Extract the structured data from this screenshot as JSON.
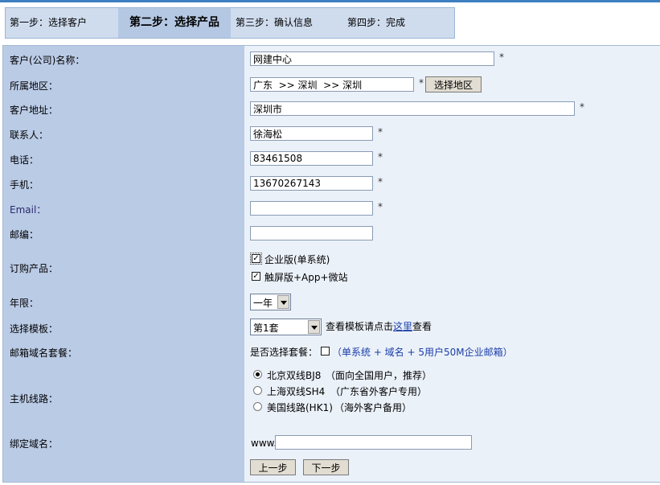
{
  "steps": {
    "step1": "第一步：选择客户",
    "step2": "第二步：选择产品",
    "step3": "第三步：确认信息",
    "step4": "第四步：完成"
  },
  "form": {
    "company": {
      "label": "客户(公司)名称：",
      "value": "网建中心",
      "required": "*"
    },
    "region": {
      "label": "所属地区：",
      "value": "广东  >> 深圳  >> 深圳",
      "required": "*",
      "button": "选择地区"
    },
    "address": {
      "label": "客户地址：",
      "value": "深圳市",
      "required": "*"
    },
    "contact": {
      "label": "联系人：",
      "value": "徐海松",
      "required": "*"
    },
    "phone": {
      "label": "电话：",
      "value": "83461508",
      "required": "*"
    },
    "mobile": {
      "label": "手机：",
      "value": "13670267143",
      "required": "*"
    },
    "email": {
      "label": "Email：",
      "value": "",
      "required": "*"
    },
    "postcode": {
      "label": "邮编：",
      "value": ""
    },
    "product": {
      "label": "订购产品：",
      "options": [
        {
          "label": "企业版(单系统)",
          "checked": true
        },
        {
          "label": "触屏版+App+微站",
          "checked": true
        }
      ]
    },
    "term": {
      "label": "年限：",
      "selected": "一年"
    },
    "template": {
      "label": "选择模板：",
      "selected": "第1套",
      "hint_prefix": "查看模板请点击",
      "hint_link": "这里",
      "hint_suffix": "查看"
    },
    "mail_package": {
      "label": "邮箱域名套餐：",
      "question": "是否选择套餐：",
      "checked": false,
      "desc": "（单系统 + 域名 + 5用户50M企业邮箱）"
    },
    "line": {
      "label": "主机线路：",
      "options": [
        {
          "name": "北京双线BJ8",
          "note": "（面向全国用户，推荐）",
          "selected": true
        },
        {
          "name": "上海双线SH4",
          "note": "（广东省外客户专用）",
          "selected": false
        },
        {
          "name": "美国线路(HK1)",
          "note": "（海外客户备用）",
          "selected": false
        }
      ]
    },
    "domain": {
      "label": "绑定域名：",
      "prefix": "www.",
      "value": ""
    }
  },
  "buttons": {
    "prev": "上一步",
    "next": "下一步"
  },
  "colors": {
    "accent": "#3d7fc0",
    "label_bg": "#bacbe6",
    "field_bg": "#ebf1f9",
    "link": "#1a3ea8"
  }
}
